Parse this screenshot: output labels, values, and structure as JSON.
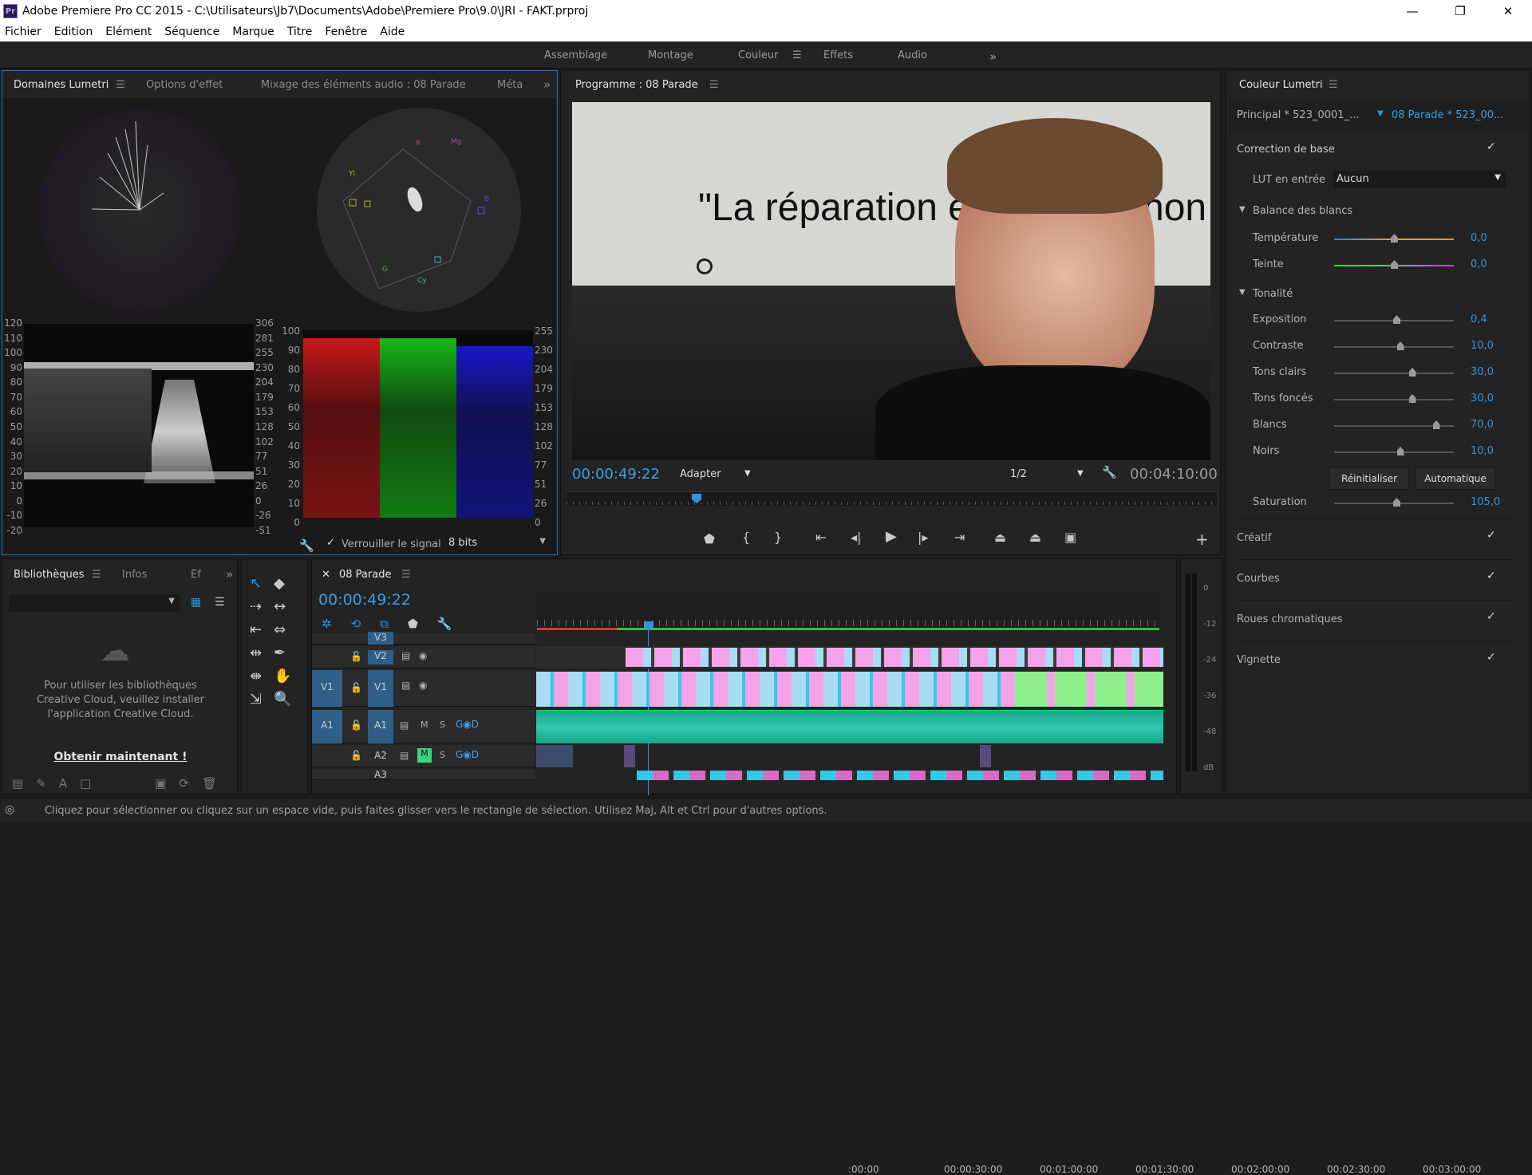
{
  "app": {
    "title": "Adobe Premiere Pro CC 2015 - C:\\Utilisateurs\\Jb7\\Documents\\Adobe\\Premiere Pro\\9.0\\JRI - FAKT.prproj",
    "icon": "Pr"
  },
  "menu": [
    "Fichier",
    "Edition",
    "Elément",
    "Séquence",
    "Marque",
    "Titre",
    "Fenêtre",
    "Aide"
  ],
  "workspaces": {
    "items": [
      "Assemblage",
      "Montage",
      "Couleur",
      "Effets",
      "Audio"
    ],
    "active": "Couleur"
  },
  "scopes_panel": {
    "tabs": [
      "Domaines Lumetri",
      "Options d'effet",
      "Mixage des éléments audio : 08 Parade",
      "Méta"
    ],
    "waveform_scale": [
      "120",
      "110",
      "100",
      "90",
      "80",
      "70",
      "60",
      "50",
      "40",
      "30",
      "20",
      "10",
      "0",
      "-10",
      "-20"
    ],
    "waveform_scale_right": [
      "306",
      "281",
      "255",
      "230",
      "204",
      "179",
      "153",
      "128",
      "102",
      "77",
      "51",
      "26",
      "0",
      "-26",
      "-51"
    ],
    "parade_scale_left": [
      "100",
      "90",
      "80",
      "70",
      "60",
      "50",
      "40",
      "30",
      "20",
      "10",
      "0"
    ],
    "parade_scale_right": [
      "255",
      "230",
      "204",
      "179",
      "153",
      "128",
      "102",
      "77",
      "51",
      "26",
      "0"
    ],
    "vectorscope_labels": [
      "R",
      "Mg",
      "B",
      "Cy",
      "G",
      "Yl"
    ],
    "lock_label": "Verrouiller le signal",
    "bits": "8 bits"
  },
  "program": {
    "title": "Programme : 08 Parade",
    "overlay_text": "\"La réparation e",
    "overlay_text_right": "non",
    "timecode": "00:00:49:22",
    "fit": "Adapter",
    "quality": "1/2",
    "duration": "00:04:10:00",
    "playhead_fraction": 0.2
  },
  "lumetri": {
    "title": "Couleur Lumetri",
    "master": "Principal * 523_0001_...",
    "clip": "08 Parade * 523_00...",
    "basic": "Correction de base",
    "lut_label": "LUT en entrée",
    "lut_value": "Aucun",
    "wb_header": "Balance des blancs",
    "tone_header": "Tonalité",
    "sliders_wb": [
      {
        "label": "Température",
        "value": "0,0",
        "pos": 0.5
      },
      {
        "label": "Teinte",
        "value": "0,0",
        "pos": 0.5
      }
    ],
    "sliders_tone": [
      {
        "label": "Exposition",
        "value": "0,4",
        "pos": 0.52
      },
      {
        "label": "Contraste",
        "value": "10,0",
        "pos": 0.55
      },
      {
        "label": "Tons clairs",
        "value": "30,0",
        "pos": 0.65
      },
      {
        "label": "Tons foncés",
        "value": "30,0",
        "pos": 0.65
      },
      {
        "label": "Blancs",
        "value": "70,0",
        "pos": 0.85
      },
      {
        "label": "Noirs",
        "value": "10,0",
        "pos": 0.55
      }
    ],
    "reset": "Réinitialiser",
    "auto": "Automatique",
    "saturation_label": "Saturation",
    "saturation_value": "105,0",
    "saturation_pos": 0.52,
    "sections": [
      "Créatif",
      "Courbes",
      "Roues chromatiques",
      "Vignette"
    ]
  },
  "libraries": {
    "tabs": [
      "Bibliothèques",
      "Infos",
      "Ef"
    ],
    "message": "Pour utiliser les bibliothèques Creative Cloud, veuillez installer l'application Creative Cloud.",
    "link": "Obtenir maintenant !"
  },
  "timeline": {
    "title": "08 Parade",
    "timecode": "00:00:49:22",
    "ruler": [
      ":00:00",
      "00:00:30:00",
      "00:01:00:00",
      "00:01:30:00",
      "00:02:00:00",
      "00:02:30:00",
      "00:03:00:00"
    ],
    "tracks": [
      {
        "id": "V3",
        "src": ""
      },
      {
        "id": "V2",
        "src": ""
      },
      {
        "id": "V1",
        "src": "V1"
      },
      {
        "id": "A1",
        "src": "A1"
      },
      {
        "id": "A2",
        "src": ""
      },
      {
        "id": "A3",
        "src": ""
      }
    ],
    "track_buttons": [
      "M",
      "S"
    ],
    "meter_scale": [
      "0",
      "-12",
      "-24",
      "-36",
      "-48",
      "dB"
    ]
  },
  "status": "Cliquez pour sélectionner ou cliquez sur un espace vide, puis faites glisser vers le rectangle de sélection. Utilisez Maj, Alt et Ctrl pour d'autres options.",
  "colors": {
    "accent": "#2f96dd",
    "panel": "#232323",
    "v1": "#a8dcf2",
    "v2": "#f4a3ea",
    "green": "#8ef08c",
    "audio": "#2fc8b0"
  }
}
